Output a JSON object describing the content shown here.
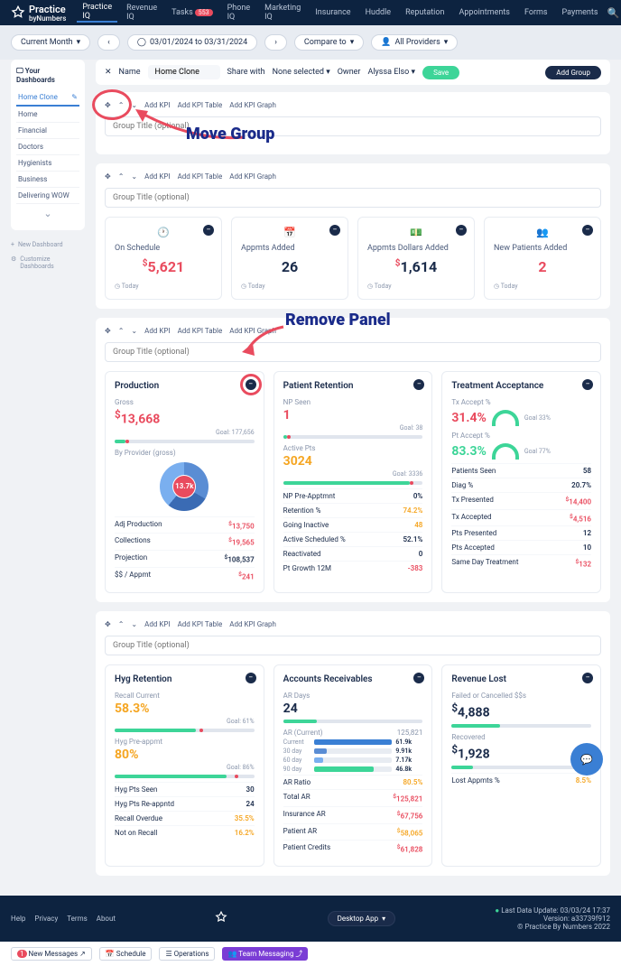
{
  "brand": {
    "name": "Practice",
    "sub": "byNumbers"
  },
  "nav": [
    "Practice IQ",
    "Revenue IQ",
    "Tasks",
    "Phone IQ",
    "Marketing IQ",
    "Insurance",
    "Huddle",
    "Reputation",
    "Appointments",
    "Forms",
    "Payments"
  ],
  "task_badge": "553",
  "filters": {
    "period": "Current Month",
    "range": "03/01/2024 to 03/31/2024",
    "compare": "Compare to",
    "providers": "All Providers"
  },
  "sidebar": {
    "title": "Your Dashboards",
    "items": [
      "Home Clone",
      "Home",
      "Financial",
      "Doctors",
      "Hygienists",
      "Business",
      "Delivering WOW"
    ],
    "links": [
      "New Dashboard",
      "Customize Dashboards"
    ]
  },
  "editor": {
    "name_label": "Name",
    "name": "Home Clone",
    "share": "Share with",
    "share_val": "None selected",
    "owner_label": "Owner",
    "owner": "Alyssa Elso",
    "save": "Save",
    "add_group": "Add Group"
  },
  "group_tools": {
    "add_kpi": "Add KPI",
    "add_table": "Add KPI Table",
    "add_graph": "Add KPI Graph",
    "placeholder": "Group Title (optional)"
  },
  "anno": {
    "move": "Move Group",
    "remove": "Remove Panel"
  },
  "kpis": [
    {
      "label": "On Schedule",
      "value": "5,621",
      "prefix": "$"
    },
    {
      "label": "Appmts Added",
      "value": "26"
    },
    {
      "label": "Appmts Dollars Added",
      "value": "1,614",
      "prefix": "$"
    },
    {
      "label": "New Patients Added",
      "value": "2"
    }
  ],
  "today": "Today",
  "production": {
    "title": "Production",
    "gross": "Gross",
    "gross_val": "13,668",
    "goal": "Goal: 177,656",
    "by_provider": "By Provider (gross)",
    "center": "13.7k",
    "rows": [
      [
        "Adj Production",
        "13,750",
        "red"
      ],
      [
        "Collections",
        "19,565",
        "red"
      ],
      [
        "Projection",
        "108,537",
        ""
      ],
      [
        "$$ / Appmt",
        "241",
        "red"
      ]
    ]
  },
  "retention": {
    "title": "Patient Retention",
    "np_seen": "NP Seen",
    "np_val": "1",
    "np_goal": "Goal: 38",
    "active": "Active Pts",
    "active_val": "3024",
    "active_goal": "Goal: 3336",
    "rows": [
      [
        "NP Pre-Apptmnt",
        "0%",
        ""
      ],
      [
        "Retention %",
        "74.2%",
        "orange"
      ],
      [
        "Going Inactive",
        "48",
        "orange"
      ],
      [
        "Active Scheduled %",
        "52.1%",
        ""
      ],
      [
        "Reactivated",
        "0",
        ""
      ],
      [
        "Pt Growth 12M",
        "-383",
        "red"
      ]
    ]
  },
  "treatment": {
    "title": "Treatment Acceptance",
    "tx_accept": "Tx Accept %",
    "tx_val": "31.4%",
    "tx_goal": "Goal 33%",
    "pt_accept": "Pt Accept %",
    "pt_val": "83.3%",
    "pt_goal": "Goal 77%",
    "rows": [
      [
        "Patients Seen",
        "58",
        ""
      ],
      [
        "Diag %",
        "20.7%",
        ""
      ],
      [
        "Tx Presented",
        "14,400",
        "red"
      ],
      [
        "Tx Accepted",
        "4,516",
        "red"
      ],
      [
        "Pts Presented",
        "12",
        ""
      ],
      [
        "Pts Accepted",
        "10",
        ""
      ],
      [
        "Same Day Treatment",
        "132",
        "red"
      ]
    ]
  },
  "hyg": {
    "title": "Hyg Retention",
    "recall": "Recall Current",
    "recall_val": "58.3%",
    "recall_goal": "Goal: 61%",
    "preappt": "Hyg Pre-appmt",
    "preappt_val": "80%",
    "preappt_goal": "Goal: 86%",
    "rows": [
      [
        "Hyg Pts Seen",
        "30",
        ""
      ],
      [
        "Hyg Pts Re-appntd",
        "24",
        ""
      ],
      [
        "Recall Overdue",
        "35.5%",
        "orange"
      ],
      [
        "Not on Recall",
        "16.2%",
        "orange"
      ]
    ]
  },
  "ar": {
    "title": "Accounts Receivables",
    "days": "AR Days",
    "days_val": "24",
    "current": "AR (Current)",
    "total": "125,821",
    "bars": [
      [
        "Current",
        "61.9k",
        100,
        "#3a7fd4"
      ],
      [
        "30 day",
        "9.91k",
        16,
        "#5a8dd4"
      ],
      [
        "60 day",
        "7.17k",
        12,
        "#7aafef"
      ],
      [
        "90 day",
        "46.8k",
        76,
        "#3dd598"
      ]
    ],
    "rows": [
      [
        "AR Ratio",
        "80.5%",
        "orange"
      ],
      [
        "Total AR",
        "125,821",
        "red"
      ],
      [
        "Insurance AR",
        "67,756",
        "red"
      ],
      [
        "Patient AR",
        "58,065",
        "orange"
      ],
      [
        "Patient Credits",
        "61,828",
        "red"
      ]
    ]
  },
  "revenue": {
    "title": "Revenue Lost",
    "failed": "Failed or Cancelled $$s",
    "failed_val": "4,888",
    "recovered": "Recovered",
    "recovered_val": "1,928",
    "rows": [
      [
        "Lost Appmts %",
        "8.5%",
        "orange"
      ]
    ]
  },
  "footer": {
    "links": [
      "Help",
      "Privacy",
      "Terms",
      "About"
    ],
    "app": "Desktop App",
    "update": "Last Data Update: 03/03/24 17:37",
    "version": "Version: a33739f912",
    "copy": "© Practice By Numbers 2022"
  },
  "status": [
    "New Messages",
    "Schedule",
    "Operations",
    "Team Messaging"
  ],
  "status_badge": "1"
}
